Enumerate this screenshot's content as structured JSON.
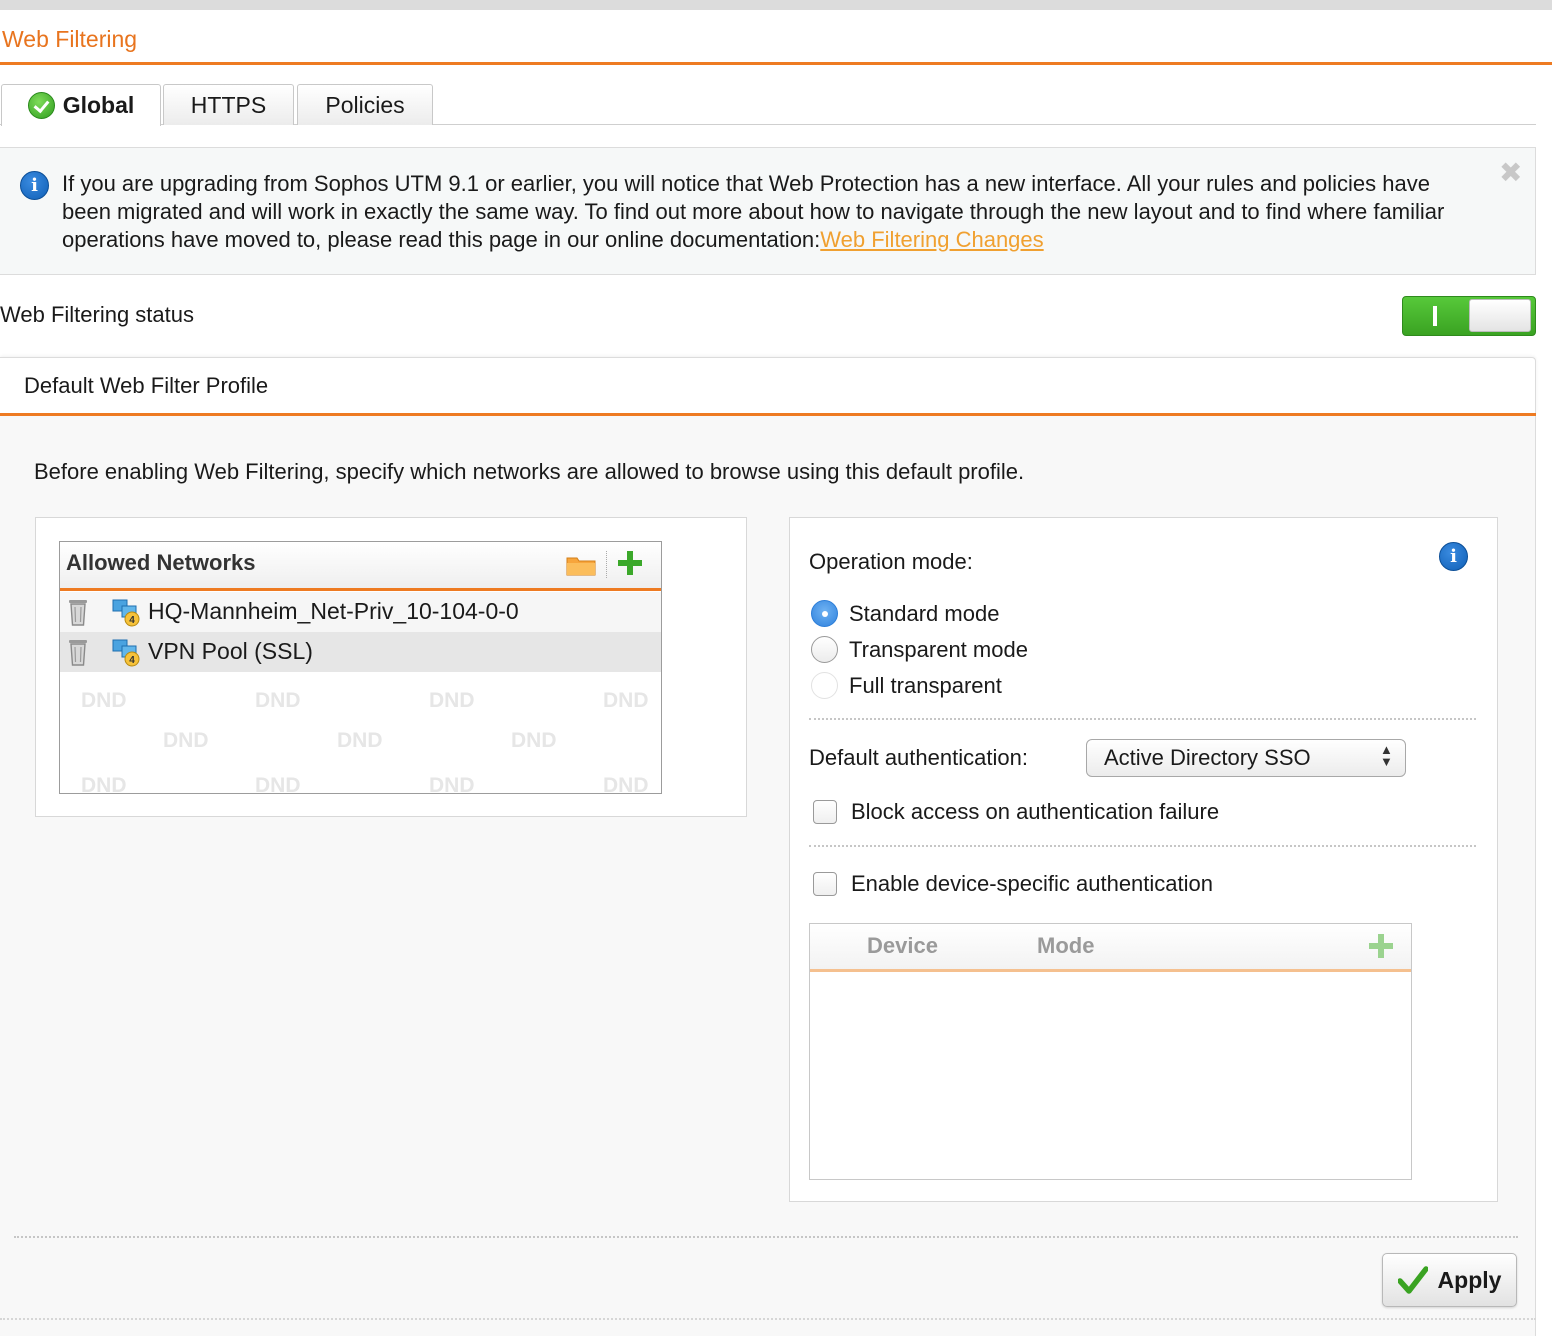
{
  "page": {
    "title": "Web Filtering"
  },
  "tabs": [
    {
      "label": "Global",
      "active": true
    },
    {
      "label": "HTTPS",
      "active": false
    },
    {
      "label": "Policies",
      "active": false
    }
  ],
  "notice": {
    "text": "If you are upgrading from Sophos UTM 9.1 or earlier, you will notice that Web Protection has a new interface. All your rules and policies have been migrated and will work in exactly the same way. To find out more about how to navigate through the new layout and to find where familiar operations have moved to, please read this page in our online documentation:",
    "link_text": "Web Filtering Changes"
  },
  "status": {
    "label": "Web Filtering status",
    "enabled": true,
    "on_mark": "I"
  },
  "profile": {
    "title": "Default Web Filter Profile",
    "intro": "Before enabling Web Filtering, specify which networks are allowed to browse using this default profile."
  },
  "allowed_networks": {
    "title": "Allowed Networks",
    "items": [
      {
        "label": "HQ-Mannheim_Net-Priv_10-104-0-0",
        "badge": "4"
      },
      {
        "label": "VPN Pool (SSL)",
        "badge": "4"
      }
    ],
    "dnd_text": "DND"
  },
  "operation": {
    "label": "Operation mode:",
    "options": [
      {
        "label": "Standard mode",
        "checked": true
      },
      {
        "label": "Transparent mode",
        "checked": false
      },
      {
        "label": "Full transparent",
        "checked": false
      }
    ]
  },
  "authentication": {
    "label": "Default authentication:",
    "selected": "Active Directory SSO",
    "block_label": "Block access on authentication failure",
    "device_label": "Enable device-specific authentication"
  },
  "device_table": {
    "columns": [
      "Device",
      "Mode"
    ]
  },
  "apply": {
    "label": "Apply"
  },
  "colors": {
    "accent": "#ee7b22",
    "link": "#f0a030",
    "toggle_on": "#3aa322"
  }
}
